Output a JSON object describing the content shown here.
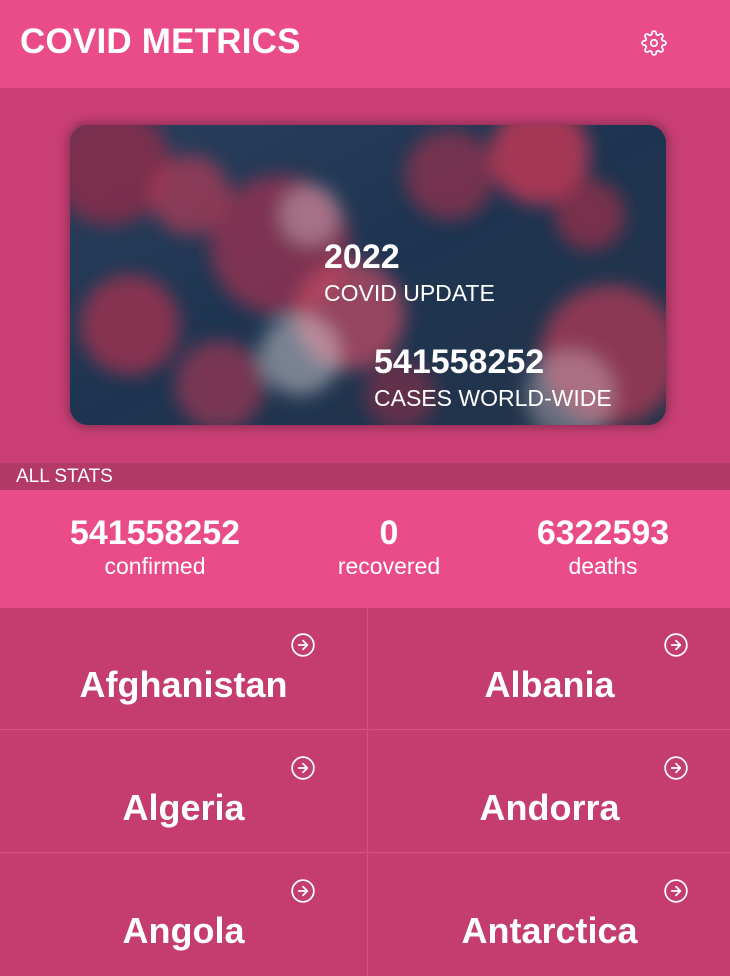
{
  "header": {
    "title": "COVID METRICS",
    "settings_icon": "gear-icon"
  },
  "hero": {
    "year": "2022",
    "subtitle": "COVID UPDATE",
    "cases": "541558252",
    "cases_label": "CASES WORLD-WIDE"
  },
  "section_label": "ALL STATS",
  "stats": [
    {
      "value": "541558252",
      "label": "confirmed"
    },
    {
      "value": "0",
      "label": "recovered"
    },
    {
      "value": "6322593",
      "label": "deaths"
    }
  ],
  "countries": [
    {
      "name": "Afghanistan"
    },
    {
      "name": "Albania"
    },
    {
      "name": "Algeria"
    },
    {
      "name": "Andorra"
    },
    {
      "name": "Angola"
    },
    {
      "name": "Antarctica"
    }
  ],
  "colors": {
    "accent": "#ea4c89",
    "background": "#c93f73",
    "tile": "#c43d6e"
  }
}
